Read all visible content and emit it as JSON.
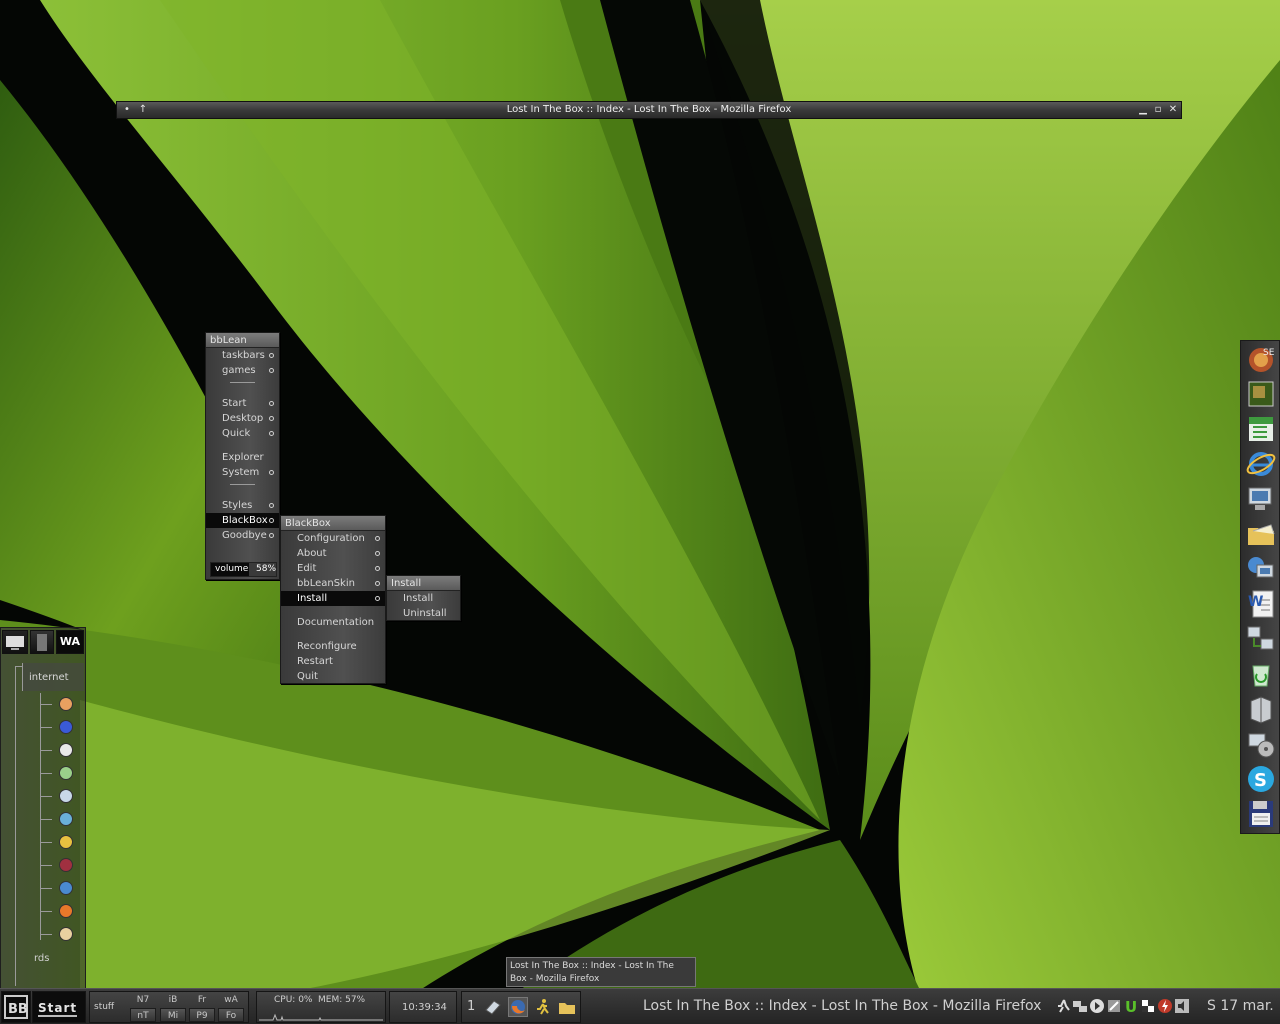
{
  "colors": {
    "menu_selected": "#0a0a0a",
    "menu_title": "#6a6a6a",
    "taskbar": "#2e2e2e",
    "leaf_green": "#7fb52a",
    "background_shadow": "#050805"
  },
  "window": {
    "title": "Lost In The Box :: Index - Lost In The Box - Mozilla Firefox",
    "btn_minimize": "▁",
    "btn_maximize": "▫",
    "btn_close": "✕"
  },
  "main_menu": {
    "title": "bbLean",
    "items": [
      {
        "label": "taskbars"
      },
      {
        "label": "games"
      },
      {
        "label": "Start"
      },
      {
        "label": "Desktop"
      },
      {
        "label": "Quick"
      },
      {
        "label": "Explorer"
      },
      {
        "label": "System"
      },
      {
        "label": "Styles"
      },
      {
        "label": "BlackBox"
      },
      {
        "label": "Goodbye"
      }
    ],
    "volume_label": "volume",
    "volume_value": "58%"
  },
  "blackbox_menu": {
    "title": "BlackBox",
    "items": [
      {
        "label": "Configuration"
      },
      {
        "label": "About"
      },
      {
        "label": "Edit"
      },
      {
        "label": "bbLeanSkin"
      },
      {
        "label": "Install"
      },
      {
        "label": "Documentation"
      },
      {
        "label": "Reconfigure"
      },
      {
        "label": "Restart"
      },
      {
        "label": "Quit"
      }
    ]
  },
  "install_menu": {
    "title": "Install",
    "items": [
      {
        "label": "Install"
      },
      {
        "label": "Uninstall"
      }
    ]
  },
  "iconbar": {
    "icons": [
      "firefox-se-icon",
      "picture-icon",
      "spreadsheet-icon",
      "internet-explorer-icon",
      "my-computer-icon",
      "open-folder-icon",
      "network-computer-icon",
      "word-document-icon",
      "network-places-icon",
      "recycle-bin-icon",
      "drive-icon",
      "media-player-icon",
      "skype-icon",
      "floppy-disk-icon"
    ]
  },
  "slit": {
    "wa_label": "WA",
    "tree_root": "internet",
    "tree_footer": "rds",
    "tree_icons": [
      "opera-icon",
      "airplane-icon",
      "chat-icon",
      "bin-icon",
      "scanner-icon",
      "contacts-icon",
      "smiley-icon",
      "music-icon",
      "globe-icon",
      "firefox-icon",
      "clock-icon"
    ]
  },
  "taskbar": {
    "start_label": "Start",
    "workspace_name": "stuff",
    "workspaces_top": [
      "N7",
      "iB",
      "Fr",
      "wA"
    ],
    "workspaces_bottom": [
      "nT",
      "Mi",
      "P9",
      "Fo"
    ],
    "cpu": "CPU: 0%",
    "mem": "MEM: 57%",
    "clock": "10:39:34",
    "desktop_number": "1",
    "active_task": "Lost In The Box :: Index - Lost In The Box - Mozilla Firefox",
    "date": "S 17 mar.",
    "tooltip": "Lost In The Box :: Index - Lost In The Box - Mozilla Firefox"
  }
}
